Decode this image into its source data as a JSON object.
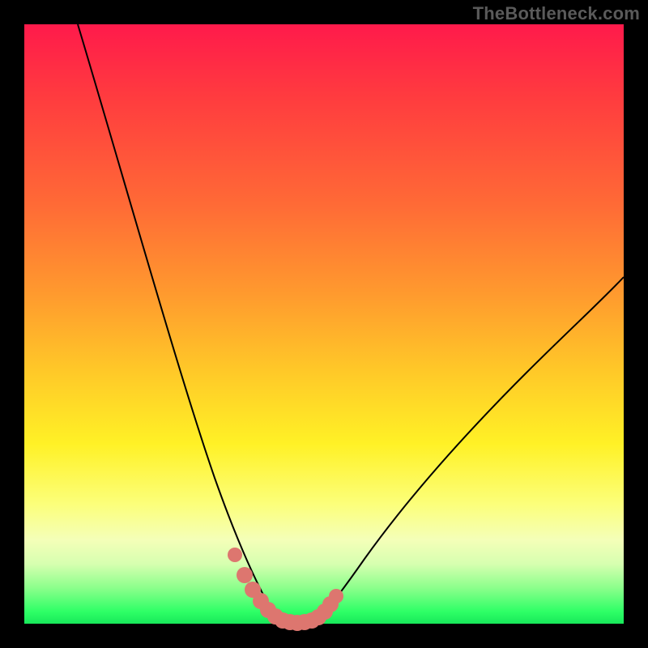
{
  "watermark": "TheBottleneck.com",
  "chart_data": {
    "type": "line",
    "title": "",
    "xlabel": "",
    "ylabel": "",
    "xlim": [
      0,
      100
    ],
    "ylim": [
      0,
      100
    ],
    "grid": false,
    "legend": false,
    "series": [
      {
        "name": "left-branch",
        "color": "#000000",
        "x": [
          9,
          12,
          15,
          18,
          21,
          24,
          27,
          30,
          31.5,
          33,
          34.5,
          36,
          37.5,
          39,
          40.5,
          41.5
        ],
        "y": [
          100,
          88,
          76,
          64,
          53,
          42,
          32,
          22,
          17.5,
          13.5,
          10,
          7,
          4.5,
          2.6,
          1.2,
          0.4
        ]
      },
      {
        "name": "right-branch",
        "color": "#000000",
        "x": [
          48.5,
          50,
          52,
          55,
          59,
          64,
          70,
          77,
          85,
          94,
          100
        ],
        "y": [
          0.4,
          1.4,
          3.3,
          7,
          12.5,
          19,
          26.5,
          34.5,
          43,
          52,
          58
        ]
      },
      {
        "name": "highlight-points",
        "color": "#dd766f",
        "type": "scatter",
        "x": [
          34.5,
          36.5,
          38,
          39.5,
          40.5,
          41.5,
          42.5,
          43.5,
          44.5,
          45.5,
          46.5,
          47.5,
          48.5,
          49.5,
          50.5,
          51.5
        ],
        "y": [
          10,
          7,
          5,
          3.3,
          2,
          1,
          0.4,
          0.1,
          0,
          0,
          0.1,
          0.3,
          0.7,
          1.4,
          2.3,
          3.5
        ]
      }
    ],
    "annotations": []
  },
  "colors": {
    "background": "#000000",
    "curve": "#000000",
    "highlight": "#dd766f",
    "watermark": "#5a5a5a"
  }
}
